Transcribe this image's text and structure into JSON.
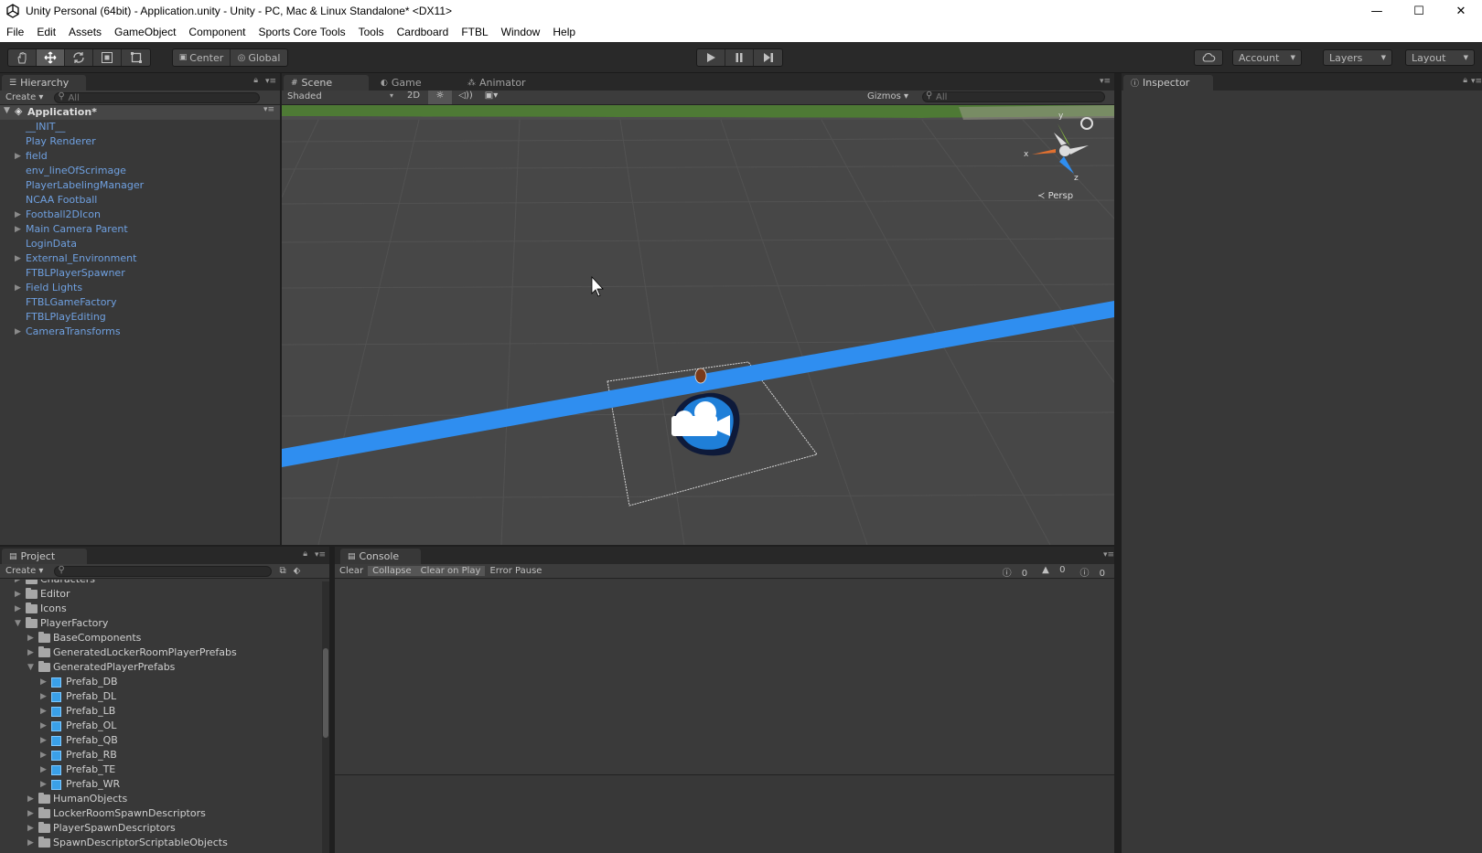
{
  "window": {
    "title": "Unity Personal (64bit) - Application.unity - Unity - PC, Mac & Linux Standalone* <DX11>",
    "minimize": "—",
    "maximize": "☐",
    "close": "✕"
  },
  "menu": [
    "File",
    "Edit",
    "Assets",
    "GameObject",
    "Component",
    "Sports Core Tools",
    "Tools",
    "Cardboard",
    "FTBL",
    "Window",
    "Help"
  ],
  "toolbar": {
    "center": "Center",
    "global": "Global",
    "account": "Account",
    "layers": "Layers",
    "layout": "Layout"
  },
  "hierarchy": {
    "tab": "Hierarchy",
    "create": "Create",
    "search_placeholder": "All",
    "scene_name": "Application*",
    "items": [
      {
        "label": "__INIT__",
        "expandable": false
      },
      {
        "label": "Play Renderer",
        "expandable": false
      },
      {
        "label": "field",
        "expandable": true
      },
      {
        "label": "env_lineOfScrimage",
        "expandable": false
      },
      {
        "label": "PlayerLabelingManager",
        "expandable": false
      },
      {
        "label": "NCAA Football",
        "expandable": false
      },
      {
        "label": "Football2DIcon",
        "expandable": true
      },
      {
        "label": "Main Camera Parent",
        "expandable": true
      },
      {
        "label": "LoginData",
        "expandable": false
      },
      {
        "label": "External_Environment",
        "expandable": true
      },
      {
        "label": "FTBLPlayerSpawner",
        "expandable": false
      },
      {
        "label": "Field Lights",
        "expandable": true
      },
      {
        "label": "FTBLGameFactory",
        "expandable": false
      },
      {
        "label": "FTBLPlayEditing",
        "expandable": false
      },
      {
        "label": "CameraTransforms",
        "expandable": true
      }
    ]
  },
  "scene": {
    "tabs": [
      "Scene",
      "Game",
      "Animator"
    ],
    "shading": "Shaded",
    "mode_2d": "2D",
    "gizmos": "Gizmos",
    "search_placeholder": "All",
    "projection": "Persp",
    "axis_x": "x",
    "axis_y": "y",
    "axis_z": "z"
  },
  "inspector": {
    "tab": "Inspector"
  },
  "project": {
    "tab": "Project",
    "create": "Create",
    "items": [
      {
        "label": "Characters",
        "depth": 1,
        "type": "folder",
        "expanded": false
      },
      {
        "label": "Editor",
        "depth": 1,
        "type": "folder",
        "expanded": false
      },
      {
        "label": "Icons",
        "depth": 1,
        "type": "folder",
        "expanded": false
      },
      {
        "label": "PlayerFactory",
        "depth": 1,
        "type": "folder",
        "expanded": true
      },
      {
        "label": "BaseComponents",
        "depth": 2,
        "type": "folder",
        "expanded": false
      },
      {
        "label": "GeneratedLockerRoomPlayerPrefabs",
        "depth": 2,
        "type": "folder",
        "expanded": false
      },
      {
        "label": "GeneratedPlayerPrefabs",
        "depth": 2,
        "type": "folder",
        "expanded": true
      },
      {
        "label": "Prefab_DB",
        "depth": 3,
        "type": "prefab",
        "expanded": false
      },
      {
        "label": "Prefab_DL",
        "depth": 3,
        "type": "prefab",
        "expanded": false
      },
      {
        "label": "Prefab_LB",
        "depth": 3,
        "type": "prefab",
        "expanded": false
      },
      {
        "label": "Prefab_OL",
        "depth": 3,
        "type": "prefab",
        "expanded": false
      },
      {
        "label": "Prefab_QB",
        "depth": 3,
        "type": "prefab",
        "expanded": false
      },
      {
        "label": "Prefab_RB",
        "depth": 3,
        "type": "prefab",
        "expanded": false
      },
      {
        "label": "Prefab_TE",
        "depth": 3,
        "type": "prefab",
        "expanded": false
      },
      {
        "label": "Prefab_WR",
        "depth": 3,
        "type": "prefab",
        "expanded": false
      },
      {
        "label": "HumanObjects",
        "depth": 2,
        "type": "folder",
        "expanded": false
      },
      {
        "label": "LockerRoomSpawnDescriptors",
        "depth": 2,
        "type": "folder",
        "expanded": false
      },
      {
        "label": "PlayerSpawnDescriptors",
        "depth": 2,
        "type": "folder",
        "expanded": false
      },
      {
        "label": "SpawnDescriptorScriptableObjects",
        "depth": 2,
        "type": "folder",
        "expanded": false
      }
    ]
  },
  "console": {
    "tab": "Console",
    "clear": "Clear",
    "collapse": "Collapse",
    "clear_on_play": "Clear on Play",
    "error_pause": "Error Pause",
    "info_count": "0",
    "warning_count": "0",
    "error_count": "0"
  },
  "colors": {
    "panel_bg": "#383838",
    "scene_bg": "#474747",
    "scrimmage_line": "#2f8ef0",
    "hierarchy_text": "#6fa0e0"
  }
}
